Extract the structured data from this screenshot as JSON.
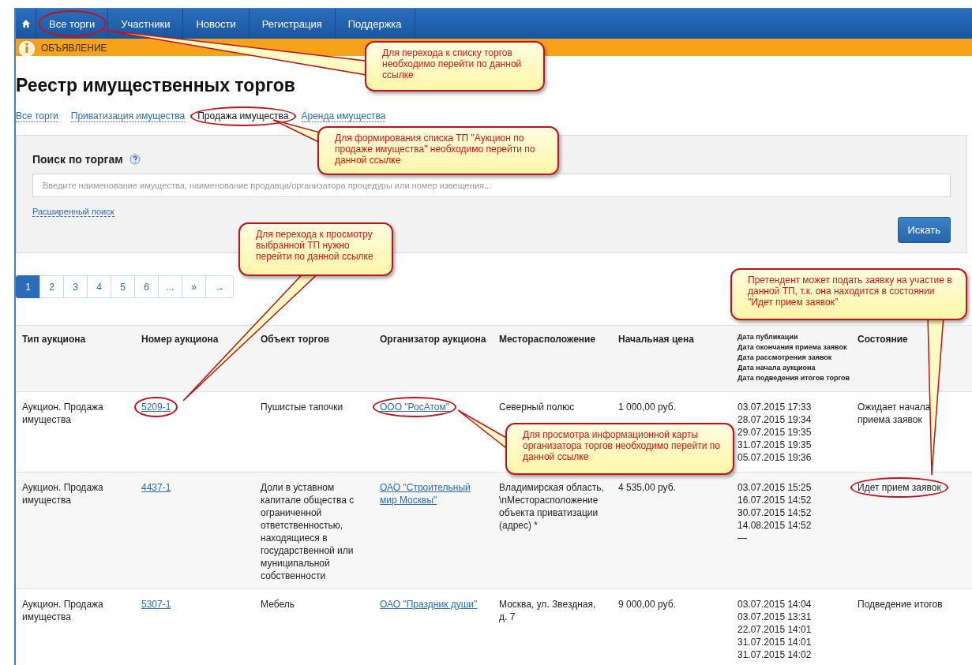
{
  "nav": {
    "items": [
      {
        "label": "Все торги",
        "selected": false,
        "circled": true
      },
      {
        "label": "Участники",
        "selected": false,
        "circled": false
      },
      {
        "label": "Новости",
        "selected": false,
        "circled": false
      },
      {
        "label": "Регистрация",
        "selected": false,
        "circled": false
      },
      {
        "label": "Поддержка",
        "selected": false,
        "circled": false
      }
    ]
  },
  "announcement": "ОБЪЯВЛЕНИЕ",
  "title": "Реестр имущественных торгов",
  "tabs": [
    {
      "label": "Все торги",
      "selected": false,
      "circled": false
    },
    {
      "label": "Приватизация имущества",
      "selected": false,
      "circled": false
    },
    {
      "label": "Продажа имущества",
      "selected": true,
      "circled": true
    },
    {
      "label": "Аренда имущества",
      "selected": false,
      "circled": false
    }
  ],
  "search": {
    "title": "Поиск по торгам",
    "placeholder": "Введите наименование имущества, наименование продавца/организатора процедуры или номер извещения...",
    "advanced_link": "Расширенный поиск",
    "button": "Искать"
  },
  "pagination": [
    {
      "label": "1",
      "selected": true
    },
    {
      "label": "2",
      "selected": false
    },
    {
      "label": "3",
      "selected": false
    },
    {
      "label": "4",
      "selected": false
    },
    {
      "label": "5",
      "selected": false
    },
    {
      "label": "6",
      "selected": false
    },
    {
      "label": "...",
      "selected": false
    },
    {
      "label": "»",
      "selected": false
    },
    {
      "label": "→",
      "selected": false
    }
  ],
  "table": {
    "columns": [
      {
        "lines": [
          "Тип аукциона"
        ]
      },
      {
        "lines": [
          "Номер аукциона"
        ]
      },
      {
        "lines": [
          "Объект торгов"
        ]
      },
      {
        "lines": [
          "Организатор аукциона"
        ]
      },
      {
        "lines": [
          "Месторасположение"
        ]
      },
      {
        "lines": [
          "Начальная цена"
        ]
      },
      {
        "lines": [
          "Дата публикации",
          "Дата окончания приема заявок",
          "Дата рассмотрения заявок",
          "Дата начала аукциона",
          "Дата подведения итогов торгов"
        ]
      },
      {
        "lines": [
          "Состояние"
        ]
      }
    ],
    "rows": [
      {
        "type": "Аукцион. Продажа имущества",
        "number": "5209-1",
        "number_circled": true,
        "object": "Пушистые тапочки",
        "organizer": "ООО \"РосАтом\"",
        "organizer_circled": true,
        "location": "Северный полюс",
        "price": "1 000,00 руб.",
        "dates": [
          "03.07.2015 17:33",
          "28.07.2015 19:34",
          "29.07.2015 19:35",
          "31.07.2015 19:35",
          "05.07.2015 19:36"
        ],
        "status": "Ожидает начала приема заявок",
        "status_circled": false
      },
      {
        "type": "Аукцион. Продажа имущества",
        "number": "4437-1",
        "number_circled": false,
        "object": "Доли в уставном капитале общества с ограниченной ответственностью, находящиеся в государственной или муниципальной собственности",
        "organizer": "ОАО \"Строительный мир Москвы\"",
        "organizer_circled": false,
        "location": "Владимирская область, \\nМесторасположение объекта приватизации (адрес) *",
        "price": "4 535,00 руб.",
        "dates": [
          "03.07.2015 15:25",
          "16.07.2015 14:52",
          "30.07.2015 14:52",
          "14.08.2015 14:52",
          "—"
        ],
        "status": "Идет прием заявок",
        "status_circled": true
      },
      {
        "type": "Аукцион. Продажа имущества",
        "number": "5307-1",
        "number_circled": false,
        "object": "Мебель",
        "organizer": "ОАО \"Праздник души\"",
        "organizer_circled": false,
        "location": "Москва, ул. Звездная, д. 7",
        "price": "9 000,00 руб.",
        "dates": [
          "03.07.2015 14:04",
          "03.07.2015 13:31",
          "22.07.2015 14:01",
          "31.07.2015 14:01",
          "31.07.2015 14:02"
        ],
        "status": "Подведение итогов",
        "status_circled": false
      }
    ]
  },
  "annotations": [
    {
      "text": "Для перехода к списку торгов необходимо перейти по данной ссылке"
    },
    {
      "text": "Для формирования списка ТП \"Аукцион по продаже имущества\" необходимо перейти по данной ссылке"
    },
    {
      "text": "Для перехода к просмотру выбранной ТП нужно перейти по данной ссылке"
    },
    {
      "text": "Для просмотра информационной карты организатора торгов необходимо перейти по данной ссылке"
    },
    {
      "text": "Претендент может подать заявку на участие в данной ТП, т.к. она находится в состоянии \"Идет прием заявок\""
    }
  ]
}
